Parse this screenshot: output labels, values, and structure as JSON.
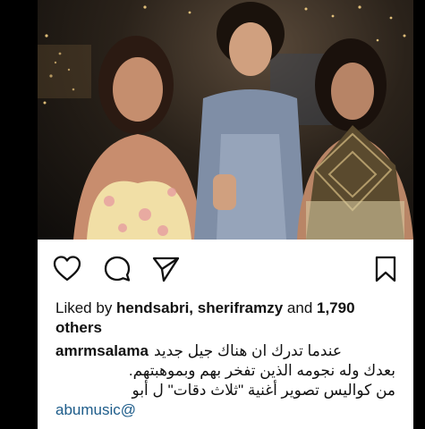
{
  "post": {
    "actions": {
      "like_icon": "heart-icon",
      "comment_icon": "comment-icon",
      "share_icon": "send-icon",
      "save_icon": "bookmark-icon"
    },
    "likes": {
      "prefix": "Liked by ",
      "user1": "hendsabri",
      "sep": ", ",
      "user2": "sheriframzy",
      "and": " and ",
      "count": "1,790",
      "suffix": " others"
    },
    "caption": {
      "username": "amrmsalama",
      "line1": "عندما تدرك ان هناك جيل جديد",
      "line2": "بعدك وله نجومه الذين تفخر بهم وبموهبتهم.",
      "line3": "من كواليس تصوير أغنية \"ثلاث دقات\" ل أبو",
      "mention": "abumusic@"
    }
  },
  "colors": {
    "link": "#1d5c8a",
    "text": "#111111",
    "background": "#ffffff"
  }
}
